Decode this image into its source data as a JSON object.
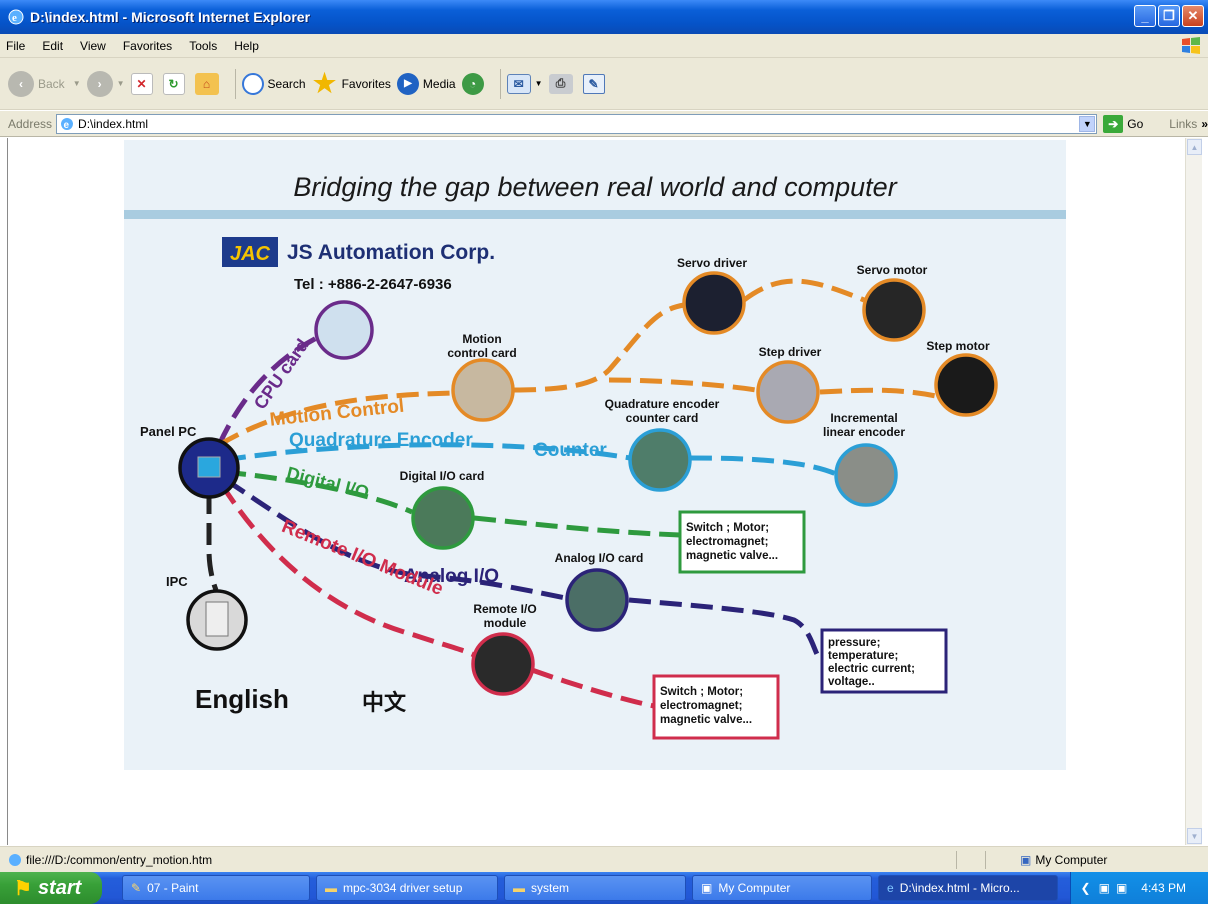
{
  "window": {
    "title": "D:\\index.html - Microsoft Internet Explorer"
  },
  "menu": [
    "File",
    "Edit",
    "View",
    "Favorites",
    "Tools",
    "Help"
  ],
  "toolbar": {
    "back": "Back",
    "search": "Search",
    "favorites": "Favorites",
    "media": "Media"
  },
  "address": {
    "label": "Address",
    "value": "D:\\index.html",
    "go": "Go",
    "links": "Links"
  },
  "banner": {
    "headline": "Bridging the gap between real world and computer",
    "brand_logo": "JAC",
    "company": "JS Automation Corp.",
    "tel": "Tel : +886-2-2647-6936",
    "paths": {
      "cpu": "CPU card",
      "motion": "Motion  Control",
      "quad": "Quadrature  Encoder",
      "counter": "Counter",
      "digital": "Digital I/O",
      "analog": "Analog I/O",
      "remote": "Remote I/O Module"
    },
    "nodes": {
      "panel_pc": "Panel PC",
      "ipc": "IPC",
      "motion_card_1": "Motion",
      "motion_card_2": "control card",
      "servo_driver": "Servo driver",
      "servo_motor": "Servo motor",
      "step_driver": "Step driver",
      "step_motor": "Step motor",
      "quad_card_1": "Quadrature encoder",
      "quad_card_2": "counter card",
      "inc_enc_1": "Incremental",
      "inc_enc_2": "linear encoder",
      "digital_card": "Digital I/O card",
      "analog_card": "Analog I/O card",
      "remote_mod_1": "Remote I/O",
      "remote_mod_2": "module"
    },
    "box_digital": [
      "Switch ; Motor;",
      "electromagnet;",
      "magnetic valve..."
    ],
    "box_analog": [
      "pressure;",
      "temperature;",
      "electric current;",
      "voltage.."
    ],
    "box_remote": [
      "Switch ; Motor;",
      "electromagnet;",
      "magnetic valve..."
    ],
    "lang_en": "English",
    "lang_zh": "中文"
  },
  "status": {
    "url": "file:///D:/common/entry_motion.htm",
    "zone": "My Computer"
  },
  "taskbar": {
    "start": "start",
    "tasks": [
      "07 - Paint",
      "mpc-3034 driver setup",
      "system",
      "My Computer",
      "D:\\index.html - Micro..."
    ],
    "clock": "4:43 PM"
  },
  "colors": {
    "motion": "#e48a26",
    "quad": "#2b9fd6",
    "digital": "#2e9a3e",
    "analog": "#2b2378",
    "remote": "#d02d4c",
    "cpu": "#6a2b8a",
    "band": "#a9cce0"
  }
}
